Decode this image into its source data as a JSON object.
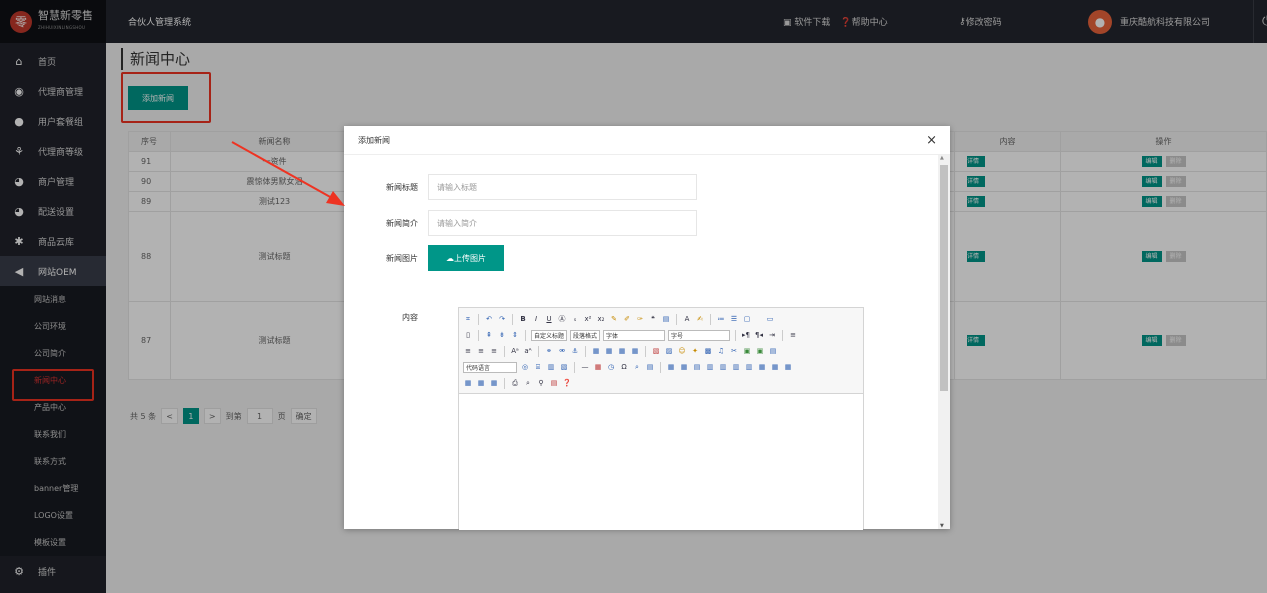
{
  "logo": {
    "mark": "零",
    "title": "智慧新零售",
    "subtitle": "ZHIHUIXINLINGSHOU"
  },
  "topbar": {
    "system_name": "合伙人管理系统",
    "download": "软件下载",
    "help": "帮助中心",
    "change_password": "修改密码",
    "company": "重庆酷航科技有限公司"
  },
  "sidebar": {
    "items": [
      {
        "label": "首页",
        "icon": "home-icon"
      },
      {
        "label": "代理商管理",
        "icon": "agent-icon"
      },
      {
        "label": "用户套餐组",
        "icon": "package-icon"
      },
      {
        "label": "代理商等级",
        "icon": "level-icon"
      },
      {
        "label": "商户管理",
        "icon": "merchant-icon"
      },
      {
        "label": "配送设置",
        "icon": "delivery-icon"
      },
      {
        "label": "商品云库",
        "icon": "cloud-icon"
      },
      {
        "label": "网站OEM",
        "icon": "oem-icon"
      }
    ],
    "sub_items": [
      "网站消息",
      "公司环境",
      "公司简介",
      "新闻中心",
      "产品中心",
      "联系我们",
      "联系方式",
      "banner管理",
      "LOGO设置",
      "模板设置"
    ],
    "plugin": "插件"
  },
  "main": {
    "page_title": "新闻中心",
    "add_button": "添加新闻",
    "table": {
      "headers": [
        "序号",
        "新闻名称",
        "内容",
        "操作"
      ],
      "rows": [
        {
          "id": "91",
          "name": "一资件"
        },
        {
          "id": "90",
          "name": "震惊体男默女泪"
        },
        {
          "id": "89",
          "name": "测试123"
        },
        {
          "id": "88",
          "name": "测试标题"
        },
        {
          "id": "87",
          "name": "测试标题"
        }
      ],
      "detail_label": "详情",
      "edit_label": "编辑",
      "delete_label": "删除"
    },
    "pager": {
      "total": "共 5 条",
      "prev": "<",
      "page": "1",
      "next": ">",
      "goto": "到第",
      "page_input": "1",
      "page_unit": "页",
      "confirm": "确定"
    }
  },
  "modal": {
    "title": "添加新闻",
    "close": "×",
    "title_label": "新闻标题",
    "title_placeholder": "请输入标题",
    "intro_label": "新闻简介",
    "intro_placeholder": "请输入简介",
    "image_label": "新闻图片",
    "upload_button": "上传图片",
    "content_label": "内容",
    "editor": {
      "custom_title": "自定义标题",
      "paragraph": "段落格式",
      "font": "字体",
      "size": "字号",
      "code_lang": "代码语言"
    }
  },
  "colors": {
    "accent": "#009688",
    "sidebar": "#20222a",
    "highlight": "#ee3322"
  }
}
